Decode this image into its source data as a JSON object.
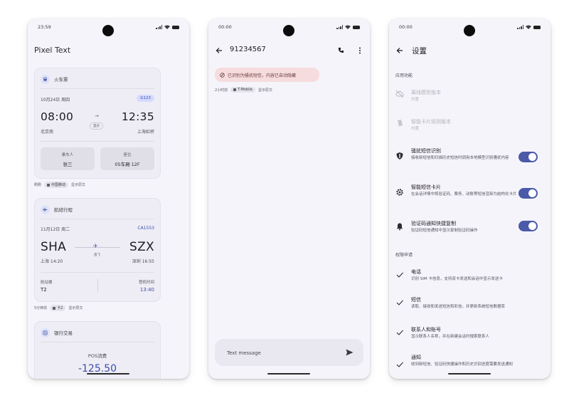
{
  "phones": [
    {
      "status": {
        "time": "23:59"
      },
      "app_title": "Pixel Text",
      "train_card": {
        "title": "火车票",
        "date": "10月24日 周四",
        "train_no": "G123",
        "depart_time": "08:00",
        "arrive_time": "12:35",
        "depart_station": "北京南",
        "arrive_station": "上海虹桥",
        "mid_label": "直达",
        "passenger_label": "乘车人",
        "passenger_value": "张三",
        "seat_label": "座位",
        "seat_value": "05车厢 12F"
      },
      "train_meta": {
        "time": "刚刚",
        "carrier": "中国移动",
        "action": "显示原文"
      },
      "flight_card": {
        "title": "航班行程",
        "date": "11月12日 周二",
        "flight_no": "CA1553",
        "from_code": "SHA",
        "to_code": "SZX",
        "mid_label": "直飞",
        "from_detail": "上海 14:20",
        "to_detail": "深圳 16:55",
        "terminal_label": "航站楼",
        "terminal_value": "T2",
        "boarding_label": "登机时间",
        "boarding_value": "13:40"
      },
      "flight_meta": {
        "time": "5分钟前",
        "carrier": "卡2",
        "action": "显示原文"
      },
      "bank_card": {
        "title": "银行交易",
        "subtitle": "POS消费",
        "amount": "-125.50"
      }
    },
    {
      "status": {
        "time": "00:00"
      },
      "conversation_title": "91234567",
      "spam_banner": "已识别为骚扰短信，内容已自动隐藏",
      "meta": {
        "time": "2小时前",
        "sim": "T-Mobile",
        "action": "显示原文"
      },
      "compose_placeholder": "Text message"
    },
    {
      "status": {
        "time": "00:00"
      },
      "title": "设置",
      "section_app": "应用功能",
      "items": [
        {
          "title": "离线模型版本",
          "desc": "内置",
          "icon": "cloud-off-icon",
          "disabled": true
        },
        {
          "title": "智能卡片规则版本",
          "desc": "内置",
          "icon": "rules-icon",
          "disabled": true
        },
        {
          "title": "骚扰短信识别",
          "desc": "接收新短信和扫描历史短信时调用本地模型识别骚扰内容",
          "icon": "shield-icon",
          "toggle": "on"
        },
        {
          "title": "智能短信卡片",
          "desc": "在会话详情中将验证码、票务、动账等短信渲染为结构化卡片",
          "icon": "gear-icon",
          "toggle": "on"
        },
        {
          "title": "验证码通知快捷复制",
          "desc": "验证码短信通知中显示复制验证码操作",
          "icon": "bell-icon",
          "toggle": "on"
        }
      ],
      "section_perm": "权限申请",
      "perms": [
        {
          "title": "电话",
          "desc": "识别 SIM 卡信息，支持双卡发送和会话中显示发送卡"
        },
        {
          "title": "短信",
          "desc": "读取、接收和发送短信和彩信，并更新系统短信数据库"
        },
        {
          "title": "联系人和账号",
          "desc": "显示联系人名称，并在新建会话时搜索联系人"
        },
        {
          "title": "通知",
          "desc": "收到新短信、验证码快捷操作和历史识别进度需要发送通知"
        }
      ]
    }
  ]
}
